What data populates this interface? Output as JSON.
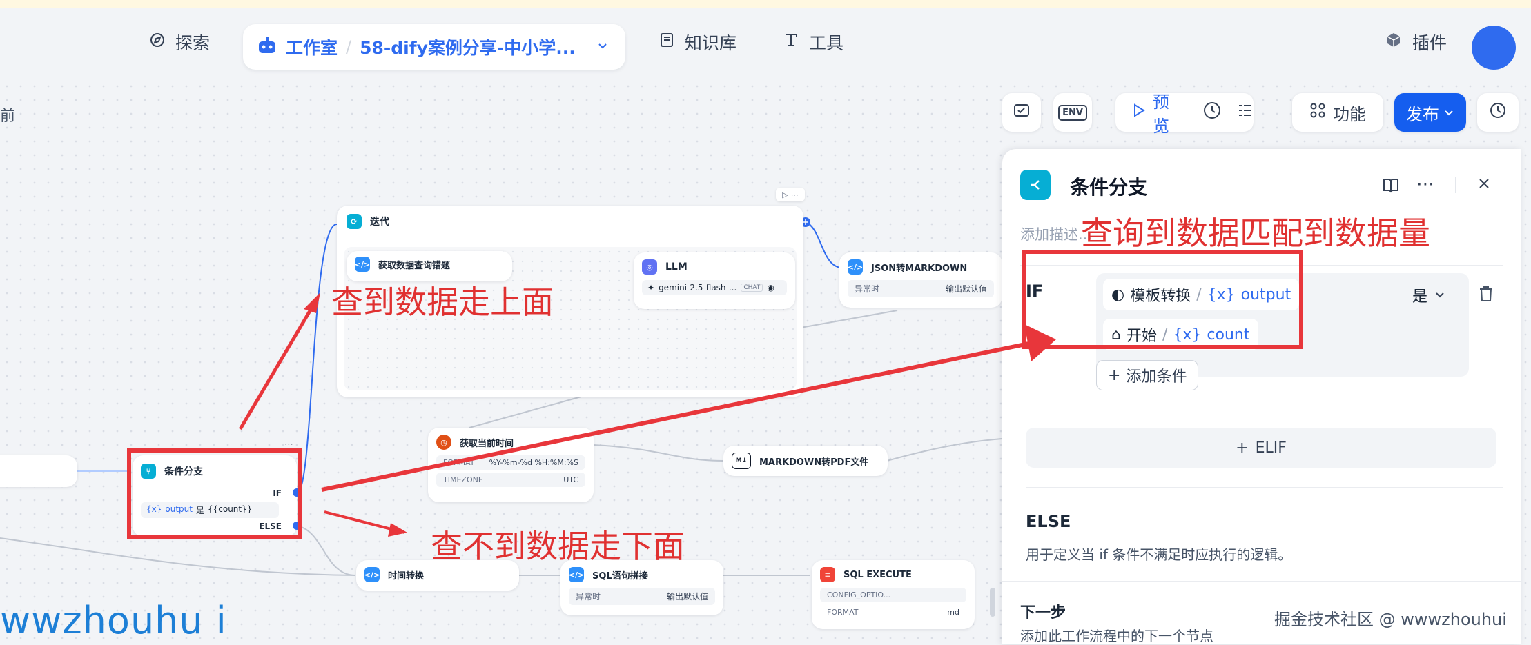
{
  "nav": {
    "explore": "探索",
    "studio": "工作室",
    "app_name": "58-dify案例分享-中小学...",
    "knowledge": "知识库",
    "tools": "工具",
    "plugins": "插件"
  },
  "canvas": {
    "left_cut_label": "前"
  },
  "toolbar": {
    "env": "ENV",
    "preview": "预览",
    "features": "功能",
    "publish": "发布"
  },
  "nodes": {
    "iteration": {
      "title": "迭代"
    },
    "fetch_data": {
      "title": "获取数据查询错题"
    },
    "llm": {
      "title": "LLM",
      "model": "gemini-2.5-flash-...",
      "mode": "CHAT"
    },
    "json_md": {
      "title": "JSON转MARKDOWN",
      "k": "异常时",
      "v": "输出默认值"
    },
    "if_else": {
      "title": "条件分支",
      "if": "IF",
      "cond_var": "output",
      "cond_op": "是",
      "cond_val": "{{count}}",
      "else": "ELSE"
    },
    "get_time": {
      "title": "获取当前时间",
      "k1": "FORMAT",
      "v1": "%Y-%m-%d %H:%M:%S",
      "k2": "TIMEZONE",
      "v2": "UTC"
    },
    "md_pdf": {
      "title": "MARKDOWN转PDF文件"
    },
    "time_conv": {
      "title": "时间转换"
    },
    "sql_concat": {
      "title": "SQL语句拼接",
      "k": "异常时",
      "v": "输出默认值"
    },
    "sql_exec": {
      "title": "SQL EXECUTE",
      "k1": "CONFIG_OPTIO...",
      "k2": "FORMAT",
      "v2": "md"
    }
  },
  "panel": {
    "title": "条件分支",
    "desc_placeholder": "添加描述...",
    "if_label": "IF",
    "cond1_node": "模板转换",
    "cond1_var": "output",
    "operator": "是",
    "cond2_node": "开始",
    "cond2_var": "count",
    "add_condition": "添加条件",
    "elif": "ELIF",
    "else_label": "ELSE",
    "else_desc": "用于定义当 if 条件不满足时应执行的逻辑。",
    "next_label": "下一步",
    "next_desc": "添加此工作流程中的下一个节点"
  },
  "annotations": {
    "top": "查到数据走上面",
    "bottom": "查不到数据走下面",
    "right": "查询到数据匹配到数据量",
    "watermark_left": "wwzhouhu i",
    "watermark_right": "掘金技术社区 @ wwwzhouhui"
  },
  "colors": {
    "accent": "#2f6bef",
    "annotation_red": "#e03131",
    "if_else_icon": "#06aed4",
    "llm_icon": "#6172f3",
    "time_icon": "#e04f16",
    "sql_icon": "#f04438"
  }
}
